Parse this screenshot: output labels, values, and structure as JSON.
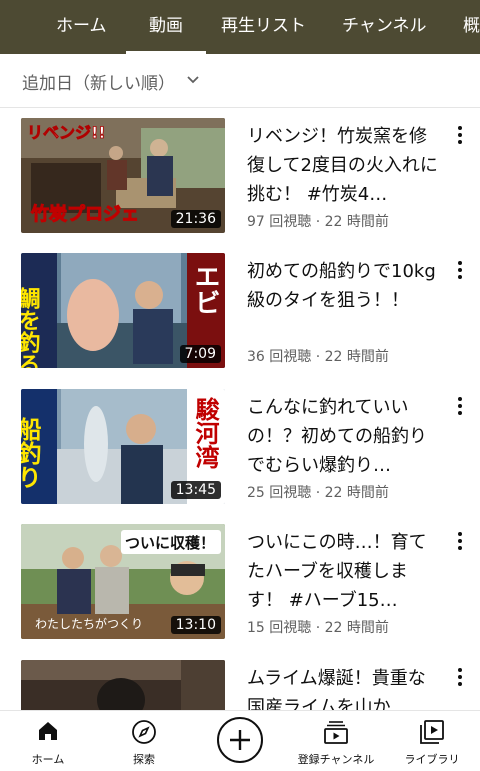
{
  "tabs": [
    {
      "label": "ホーム",
      "active": false
    },
    {
      "label": "動画",
      "active": true
    },
    {
      "label": "再生リスト",
      "active": false
    },
    {
      "label": "チャンネル",
      "active": false
    },
    {
      "label": "概",
      "active": false
    }
  ],
  "sort": {
    "label": "追加日（新しい順）"
  },
  "videos": [
    {
      "title": "リベンジ！竹炭窯を修復して2度目の火入れに挑む！ #竹炭4…",
      "views": "97 回視聴",
      "age": "22 時間前",
      "duration": "21:36",
      "thumb_text": [
        "リベンジ!!",
        "竹炭プロジェ"
      ]
    },
    {
      "title": "初めての船釣りで10kg級のタイを狙う！！",
      "views": "36 回視聴",
      "age": "22 時間前",
      "duration": "7:09",
      "thumb_text": [
        "鯛を釣る",
        "エビ"
      ]
    },
    {
      "title": "こんなに釣れていいの！？初めての船釣りでむらい爆釣り…",
      "views": "25 回視聴",
      "age": "22 時間前",
      "duration": "13:45",
      "thumb_text": [
        "船釣り",
        "駿河湾"
      ]
    },
    {
      "title": "ついにこの時…！育てたハーブを収穫します！ #ハーブ15…",
      "views": "15 回視聴",
      "age": "22 時間前",
      "duration": "13:10",
      "thumb_text": [
        "ついに収穫！",
        "わたしたちがつくり"
      ]
    },
    {
      "title": "ムライム爆誕！貴重な国産ライムを山か",
      "views": "",
      "age": "",
      "duration": "",
      "thumb_text": []
    }
  ],
  "meta_separator": "·",
  "bottom_nav": [
    {
      "label": "ホーム",
      "icon": "home-icon"
    },
    {
      "label": "探索",
      "icon": "compass-icon"
    },
    {
      "label": "",
      "icon": "plus-icon"
    },
    {
      "label": "登録チャンネル",
      "icon": "subscriptions-icon"
    },
    {
      "label": "ライブラリ",
      "icon": "library-icon"
    }
  ],
  "colors": {
    "header_bg": "#4d4a33",
    "text": "#0f0f0f",
    "secondary_text": "#606060"
  }
}
